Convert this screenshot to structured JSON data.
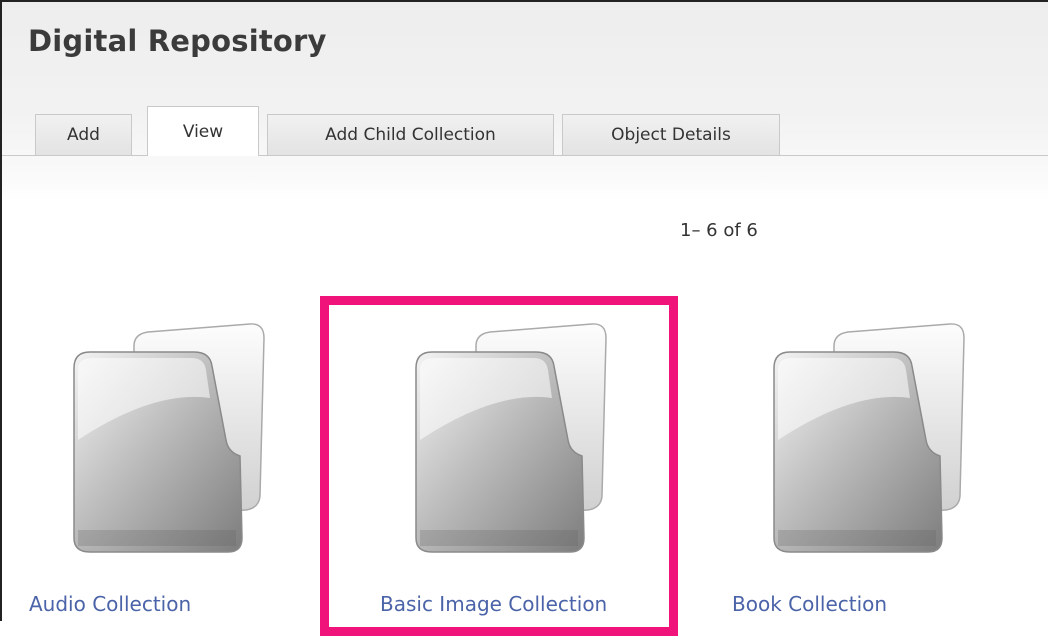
{
  "header": {
    "title": "Digital Repository"
  },
  "tabs": [
    {
      "label": "Add"
    },
    {
      "label": "View",
      "active": true
    },
    {
      "label": "Add Child Collection"
    },
    {
      "label": "Object Details"
    }
  ],
  "pager": {
    "text": "1– 6 of 6"
  },
  "collections": [
    {
      "label": "Audio Collection",
      "icon": "folder-icon"
    },
    {
      "label": "Basic Image Collection",
      "icon": "folder-icon",
      "highlighted": true
    },
    {
      "label": "Book Collection",
      "icon": "folder-icon"
    }
  ],
  "colors": {
    "highlight": "#f0147a",
    "link": "#4b63a8",
    "title": "#3b3b3b"
  }
}
